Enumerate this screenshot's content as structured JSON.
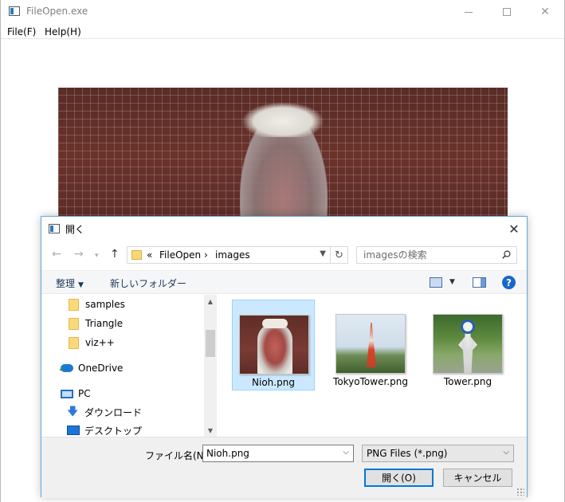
{
  "app": {
    "title": "FileOpen.exe",
    "menu": [
      "File(F)",
      "Help(H)"
    ]
  },
  "dialog": {
    "title": "開く",
    "breadcrumb": {
      "overflow": "«",
      "items": [
        "FileOpen",
        "images"
      ],
      "separator": "›"
    },
    "search": {
      "placeholder": "imagesの検索"
    },
    "toolbar": {
      "organize_label": "整理",
      "new_folder_label": "新しいフォルダー",
      "help_label": "?"
    },
    "nav_pane": {
      "items": [
        {
          "label": "samples",
          "icon": "folder-icon"
        },
        {
          "label": "Triangle",
          "icon": "folder-icon"
        },
        {
          "label": "viz++",
          "icon": "folder-icon"
        },
        {
          "label": "OneDrive",
          "icon": "onedrive-icon"
        },
        {
          "label": "PC",
          "icon": "pc-icon"
        },
        {
          "label": "ダウンロード",
          "icon": "download-icon"
        },
        {
          "label": "デスクトップ",
          "icon": "desktop-icon"
        }
      ]
    },
    "files": [
      {
        "name": "Nioh.png",
        "selected": true
      },
      {
        "name": "TokyoTower.png",
        "selected": false
      },
      {
        "name": "Tower.png",
        "selected": false
      }
    ],
    "filename_label": "ファイル名(N):",
    "filename_value": "Nioh.png",
    "filter_value": "PNG Files (*.png)",
    "open_button": "開く(O)",
    "cancel_button": "キャンセル",
    "close_glyph": "✕"
  },
  "colors": {
    "accent": "#0078d7",
    "selection_bg": "#cce8ff",
    "selection_border": "#99d1ff",
    "folder": "#fbd97a"
  }
}
